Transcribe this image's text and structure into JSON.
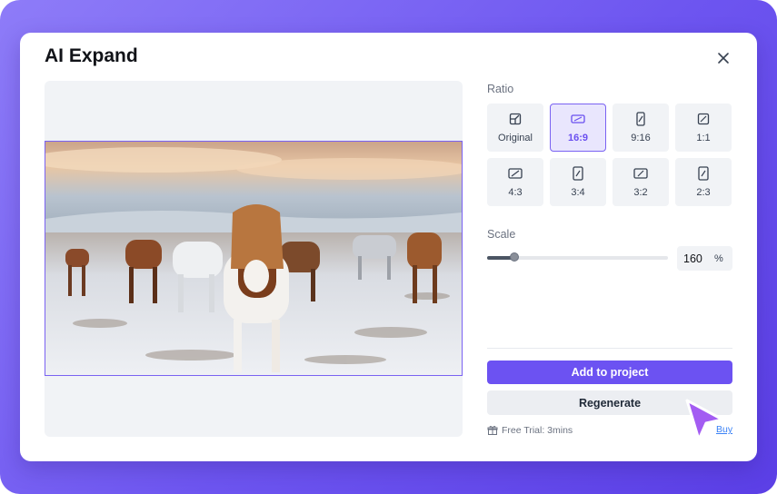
{
  "dialog": {
    "title": "AI Expand"
  },
  "ratio": {
    "label": "Ratio",
    "selected": "16:9",
    "options": [
      {
        "label": "Original",
        "icon": "original-crop-icon"
      },
      {
        "label": "16:9",
        "icon": "ratio-16-9-icon"
      },
      {
        "label": "9:16",
        "icon": "ratio-9-16-icon"
      },
      {
        "label": "1:1",
        "icon": "ratio-1-1-icon"
      },
      {
        "label": "4:3",
        "icon": "ratio-4-3-icon"
      },
      {
        "label": "3:4",
        "icon": "ratio-3-4-icon"
      },
      {
        "label": "3:2",
        "icon": "ratio-3-2-icon"
      },
      {
        "label": "2:3",
        "icon": "ratio-2-3-icon"
      }
    ]
  },
  "scale": {
    "label": "Scale",
    "value": "160",
    "unit": "%",
    "slider_fraction": 0.15
  },
  "actions": {
    "add_label": "Add to project",
    "regenerate_label": "Regenerate"
  },
  "trial": {
    "text": "Free Trial: 3mins",
    "buy_label": "Buy"
  },
  "colors": {
    "accent": "#6c52f2",
    "accent_soft": "#e9e6fd",
    "link": "#3b82f6"
  }
}
